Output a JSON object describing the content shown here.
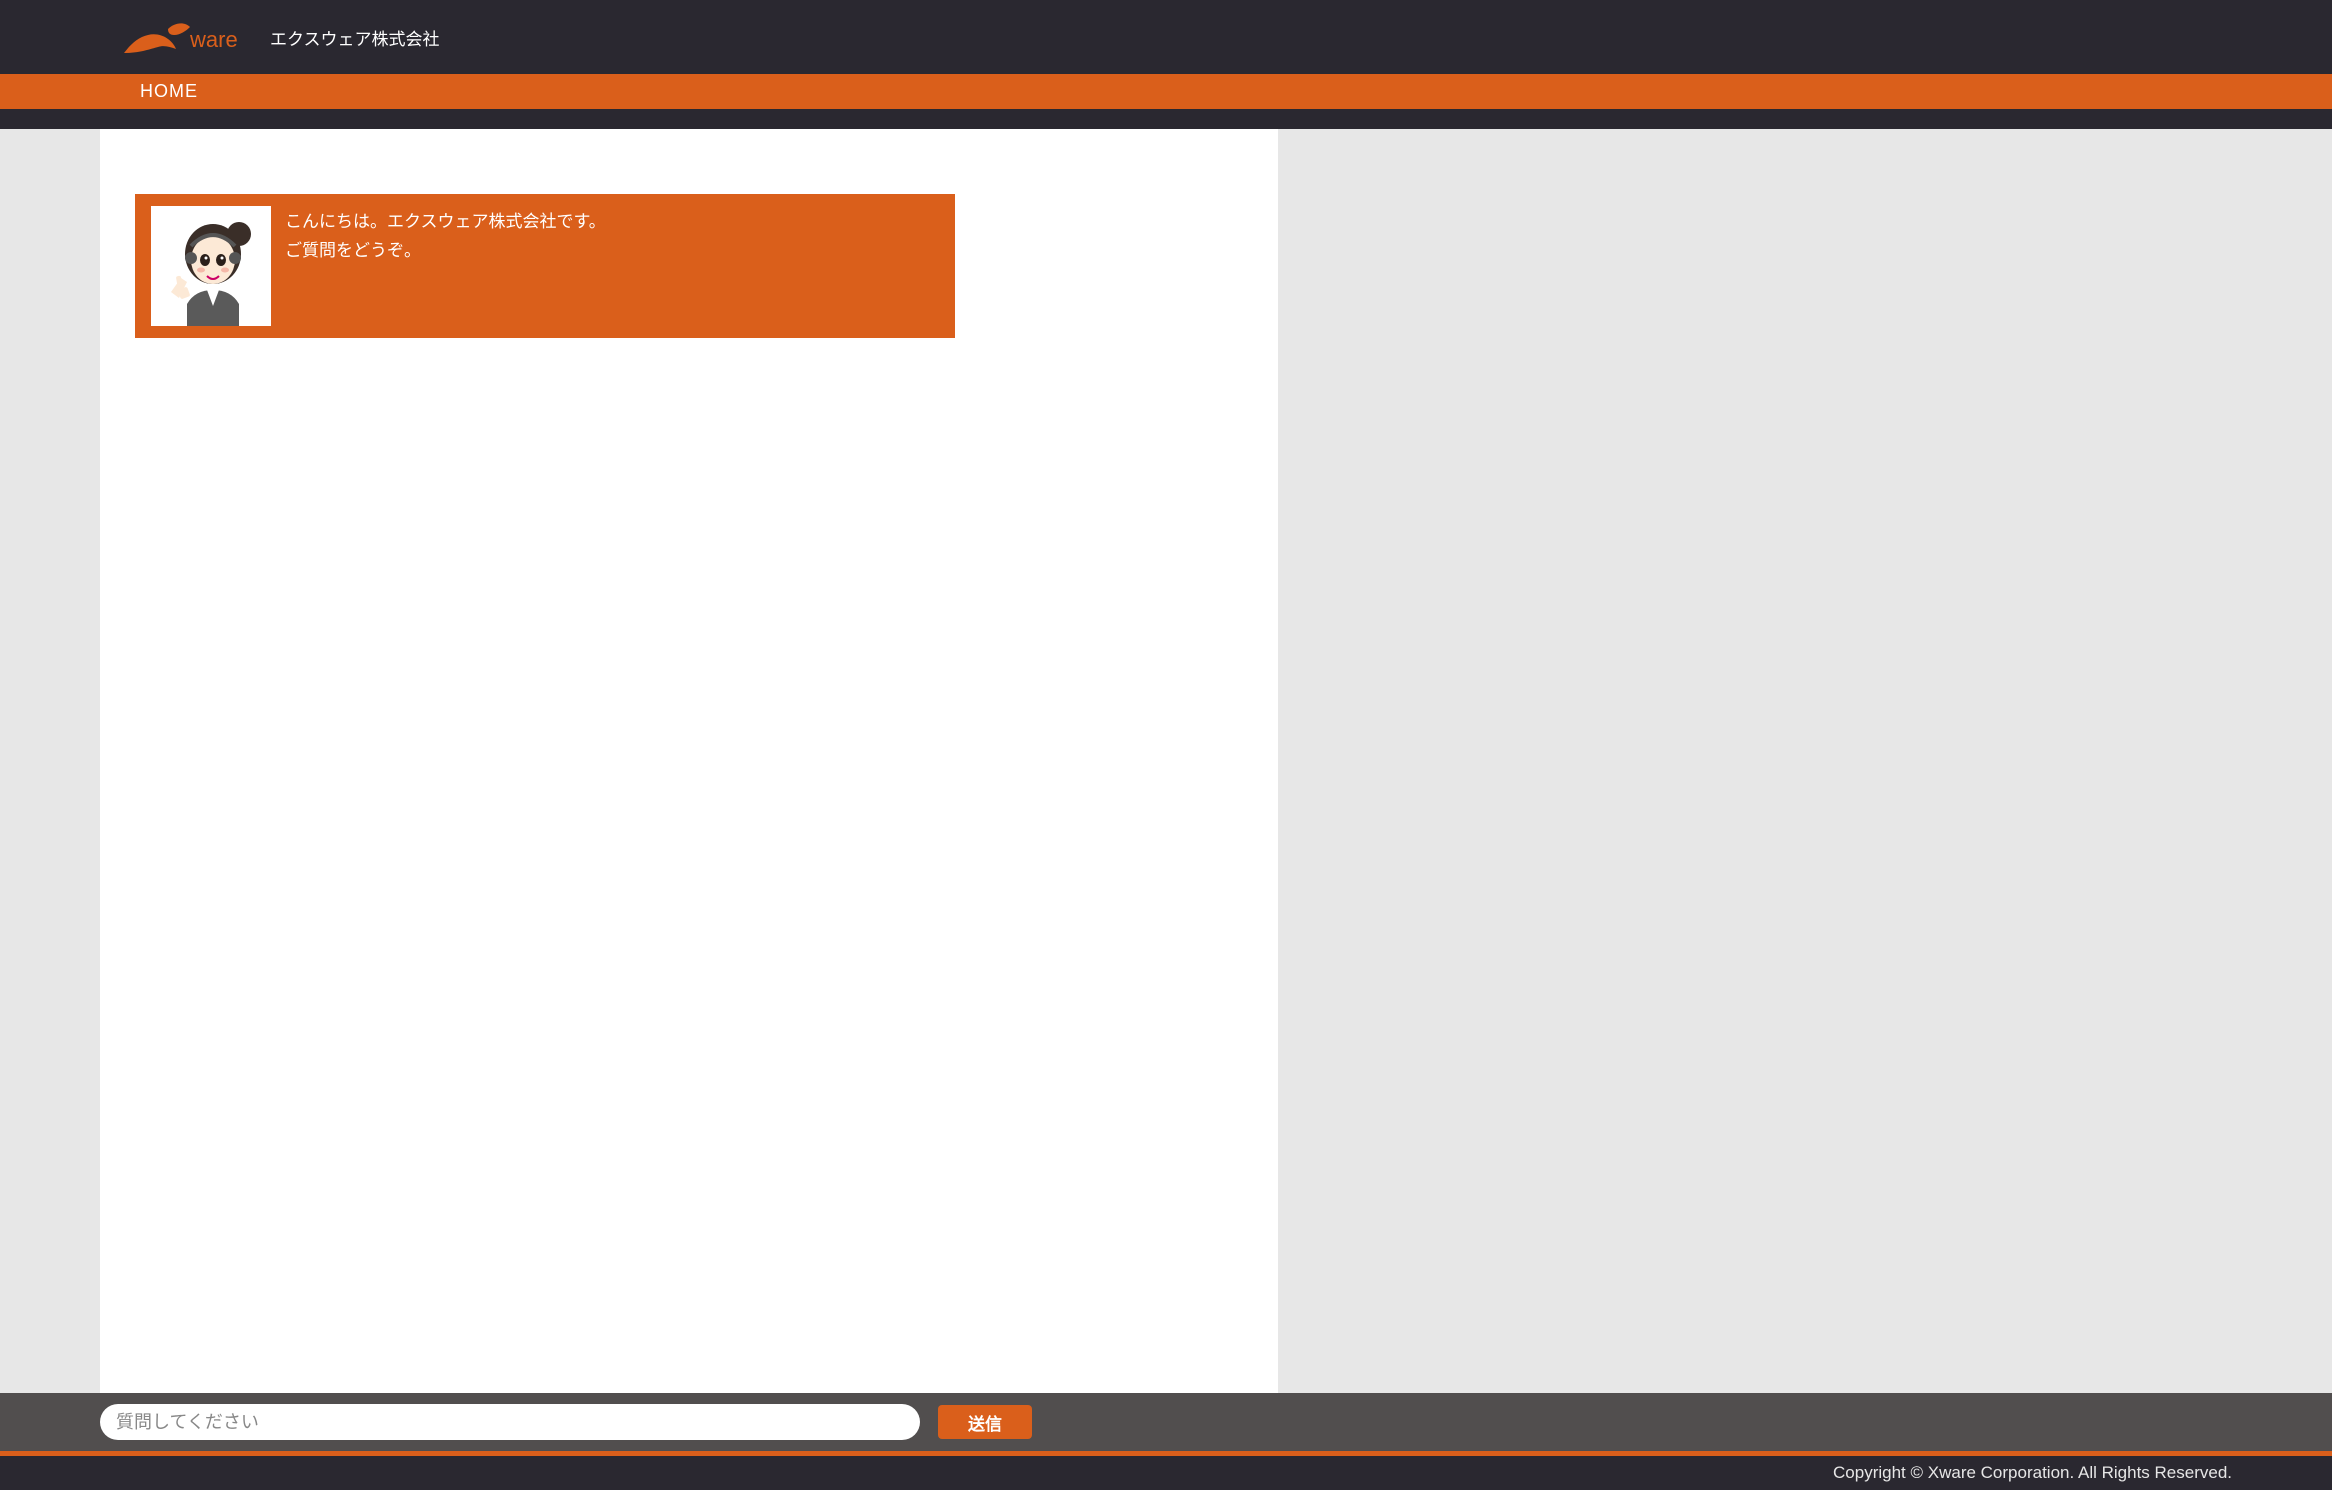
{
  "header": {
    "brand_word": "ware",
    "company_jp": "エクスウェア株式会社"
  },
  "nav": {
    "home": "HOME"
  },
  "chat": {
    "greeting": "こんにちは。エクスウェア株式会社です。\nご質問をどうぞ。"
  },
  "input": {
    "placeholder": "質問してください",
    "send_label": "送信"
  },
  "footer": {
    "copyright": "Copyright © Xware Corporation. All Rights Reserved."
  }
}
